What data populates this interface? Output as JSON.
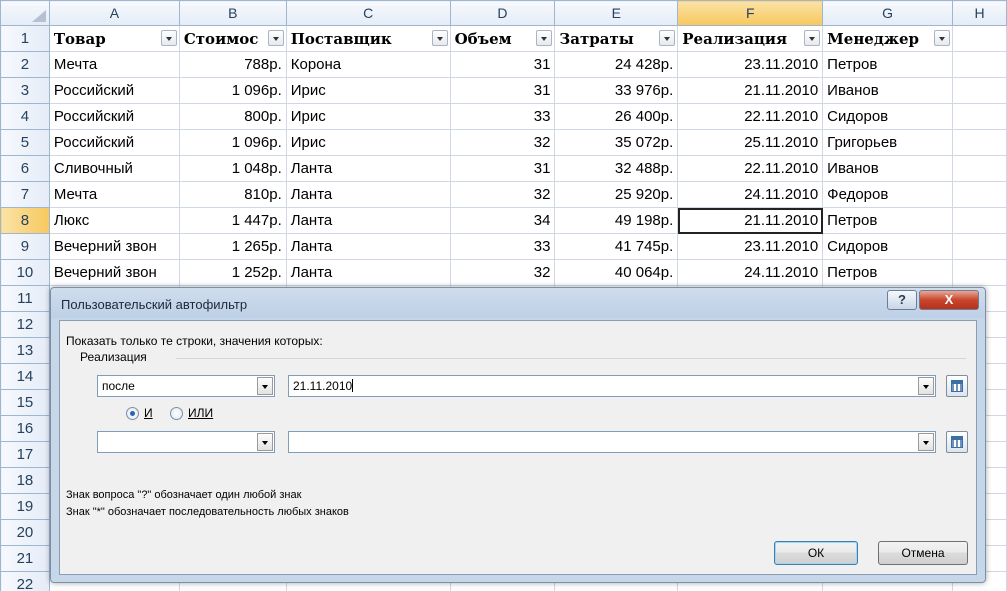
{
  "columns": [
    "A",
    "B",
    "C",
    "D",
    "E",
    "F",
    "G",
    "H"
  ],
  "row_numbers": [
    "1",
    "2",
    "3",
    "4",
    "5",
    "6",
    "7",
    "8",
    "9",
    "10",
    "11",
    "12",
    "13",
    "14",
    "15",
    "16",
    "17",
    "18",
    "19",
    "20",
    "21",
    "22"
  ],
  "table_headers": [
    "Товар",
    "Стоимос",
    "Поставщик",
    "Объем",
    "Затраты",
    "Реализация",
    "Менеджер"
  ],
  "rows": [
    [
      "Мечта",
      "788р.",
      "Корона",
      "31",
      "24 428р.",
      "23.11.2010",
      "Петров"
    ],
    [
      "Российский",
      "1 096р.",
      "Ирис",
      "31",
      "33 976р.",
      "21.11.2010",
      "Иванов"
    ],
    [
      "Российский",
      "800р.",
      "Ирис",
      "33",
      "26 400р.",
      "22.11.2010",
      "Сидоров"
    ],
    [
      "Российский",
      "1 096р.",
      "Ирис",
      "32",
      "35 072р.",
      "25.11.2010",
      "Григорьев"
    ],
    [
      "Сливочный",
      "1 048р.",
      "Ланта",
      "31",
      "32 488р.",
      "22.11.2010",
      "Иванов"
    ],
    [
      "Мечта",
      "810р.",
      "Ланта",
      "32",
      "25 920р.",
      "24.11.2010",
      "Федоров"
    ],
    [
      "Люкс",
      "1 447р.",
      "Ланта",
      "34",
      "49 198р.",
      "21.11.2010",
      "Петров"
    ],
    [
      "Вечерний звон",
      "1 265р.",
      "Ланта",
      "33",
      "41 745р.",
      "23.11.2010",
      "Сидоров"
    ],
    [
      "Вечерний звон",
      "1 252р.",
      "Ланта",
      "32",
      "40 064р.",
      "24.11.2010",
      "Петров"
    ]
  ],
  "dialog": {
    "title": "Пользовательский автофильтр",
    "help_label": "?",
    "close_label": "X",
    "prompt": "Показать только те строки, значения которых:",
    "group_label": "Реализация",
    "condition1": {
      "operator": "после",
      "value": "21.11.2010"
    },
    "logic": {
      "and_label": "И",
      "or_label": "ИЛИ",
      "selected": "and"
    },
    "condition2": {
      "operator": "",
      "value": ""
    },
    "hint1": "Знак вопроса \"?\" обозначает один любой знак",
    "hint2": "Знак \"*\" обозначает последовательность любых знаков",
    "ok_label": "ОК",
    "cancel_label": "Отмена"
  }
}
